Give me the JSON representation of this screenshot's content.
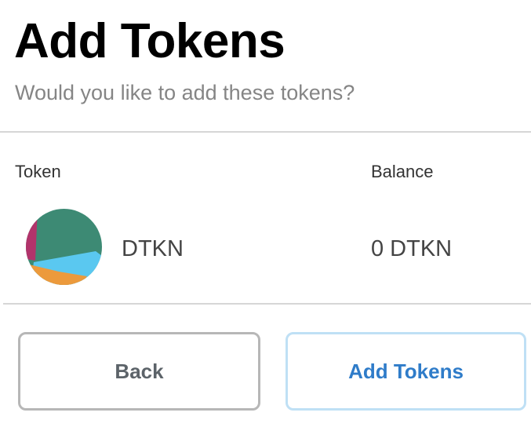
{
  "header": {
    "title": "Add Tokens",
    "subtitle": "Would you like to add these tokens?"
  },
  "table": {
    "columns": [
      "Token",
      "Balance"
    ],
    "rows": [
      {
        "symbol": "DTKN",
        "balance": "0 DTKN",
        "avatar_colors": [
          "#3d8a74",
          "#5ac8f0",
          "#ec9a3c",
          "#b2336b"
        ]
      }
    ]
  },
  "actions": {
    "back_label": "Back",
    "add_label": "Add Tokens"
  },
  "colors": {
    "accent": "#2f7cc9",
    "divider": "#d6d6d6"
  }
}
